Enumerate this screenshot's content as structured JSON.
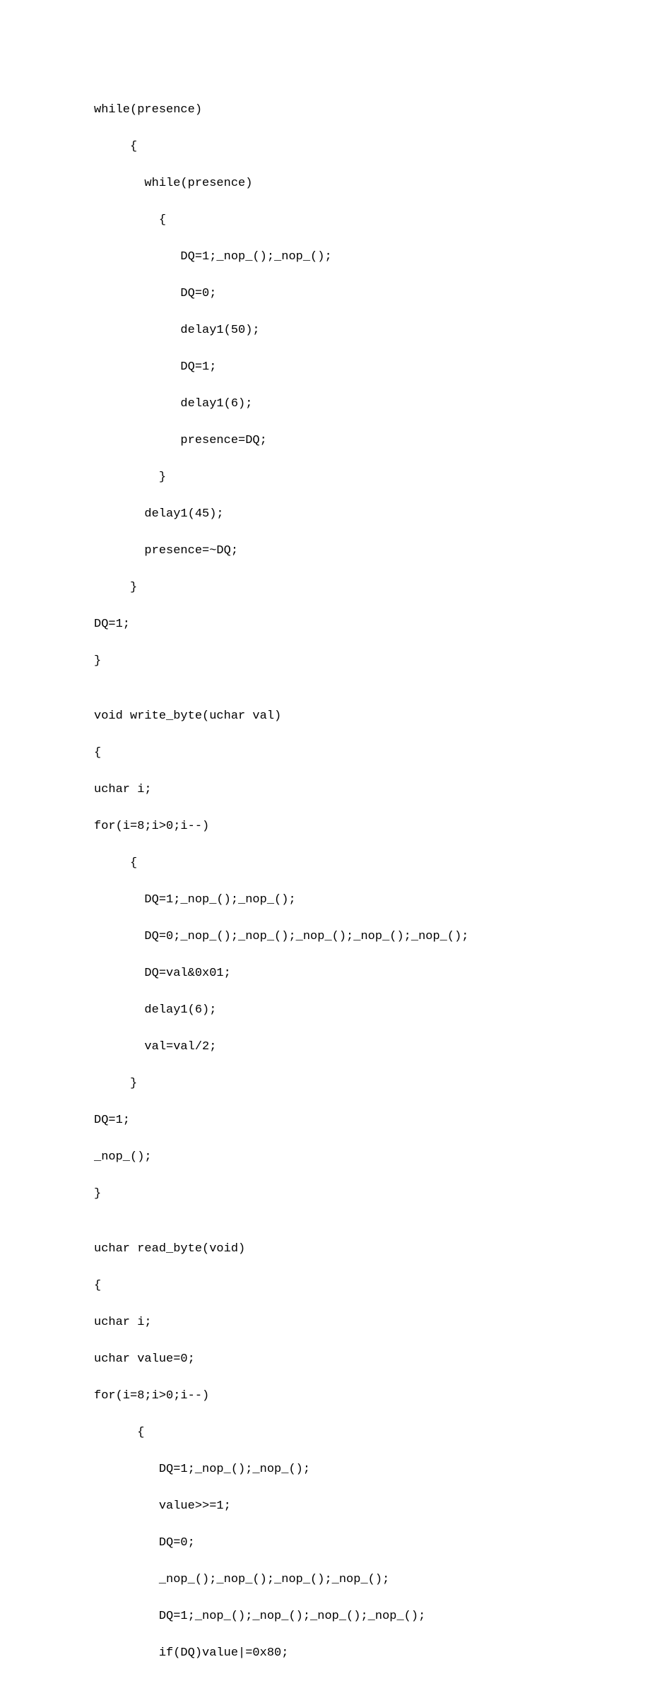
{
  "lines": [
    "while(presence)",
    "     {",
    "       while(presence)",
    "         {",
    "            DQ=1;_nop_();_nop_();",
    "            DQ=0;",
    "            delay1(50);",
    "            DQ=1;",
    "            delay1(6);",
    "            presence=DQ;",
    "         }",
    "       delay1(45);",
    "       presence=~DQ;",
    "     }",
    "DQ=1;",
    "}",
    "",
    "void write_byte(uchar val)",
    "{",
    "uchar i;",
    "for(i=8;i>0;i--)",
    "     {",
    "       DQ=1;_nop_();_nop_();",
    "       DQ=0;_nop_();_nop_();_nop_();_nop_();_nop_();",
    "       DQ=val&0x01;",
    "       delay1(6);",
    "       val=val/2;",
    "     }",
    "DQ=1;",
    "_nop_();",
    "}",
    "",
    "uchar read_byte(void)",
    "{",
    "uchar i;",
    "uchar value=0;",
    "for(i=8;i>0;i--)",
    "      {",
    "         DQ=1;_nop_();_nop_();",
    "         value>>=1;",
    "         DQ=0;",
    "         _nop_();_nop_();_nop_();_nop_();",
    "         DQ=1;_nop_();_nop_();_nop_();_nop_();",
    "         if(DQ)value|=0x80;"
  ]
}
